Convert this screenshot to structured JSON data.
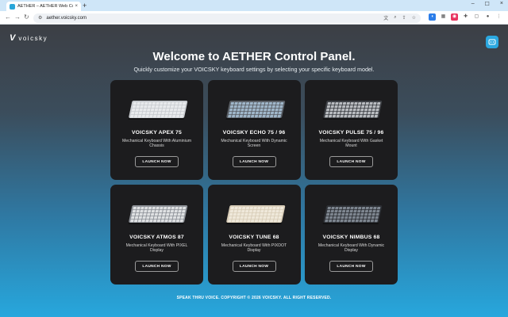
{
  "browser": {
    "tab_title": "AETHER – AETHER Web Control",
    "tab_close": "×",
    "new_tab": "+",
    "window_controls": [
      "–",
      "☐",
      "×"
    ],
    "url": "aether.voicsky.com"
  },
  "site": {
    "logo_mark": "V",
    "logo_text": "voicsky"
  },
  "hero": {
    "title": "Welcome to AETHER Control Panel.",
    "subtitle": "Quickly customize your VOICSKY keyboard settings by selecting your specific keyboard model."
  },
  "products": [
    {
      "name": "VOICSKY APEX 75",
      "description": "Mechanical Keyboard With Aluminium Chassis",
      "button": "LAUNCH NOW",
      "image_icon": "keyboard-apex-75",
      "case_color": "#c9ccd0",
      "key_color": "#e8eaec"
    },
    {
      "name": "VOICSKY ECHO 75 / 96",
      "description": "Mechanical Keyboard With Dynamic Screen",
      "button": "LAUNCH NOW",
      "image_icon": "keyboard-echo-75-96",
      "case_color": "#5a5f66",
      "key_color": "#9fb6c9"
    },
    {
      "name": "VOICSKY PULSE 75 / 96",
      "description": "Mechanical Keyboard With Gasket Mount",
      "button": "LAUNCH NOW",
      "image_icon": "keyboard-pulse-75-96",
      "case_color": "#3d4045",
      "key_color": "#b9bcc0"
    },
    {
      "name": "VOICSKY ATMOS 87",
      "description": "Mechanical Keyboard With PIXEL Display",
      "button": "LAUNCH NOW",
      "image_icon": "keyboard-atmos-87",
      "case_color": "#8e9298",
      "key_color": "#dfe1e3"
    },
    {
      "name": "VOICSKY TUNE 68",
      "description": "Mechanical Keyboard With PIXDOT Display",
      "button": "LAUNCH NOW",
      "image_icon": "keyboard-tune-68",
      "case_color": "#d8cdb8",
      "key_color": "#efe8da"
    },
    {
      "name": "VOICSKY NIMBUS 68",
      "description": "Mechanical Keyboard With Dynamic Display",
      "button": "LAUNCH NOW",
      "image_icon": "keyboard-nimbus-68",
      "case_color": "#2c2f34",
      "key_color": "#7e8690"
    }
  ],
  "footer": {
    "text": "SPEAK THRU VOICE. COPYRIGHT © 2026 VOICSKY. ALL RIGHT RESERVED."
  },
  "colors": {
    "accent": "#2ba8e0",
    "card_bg": "#1c1c1e",
    "page_gradient_bottom": "#27a7dd"
  }
}
